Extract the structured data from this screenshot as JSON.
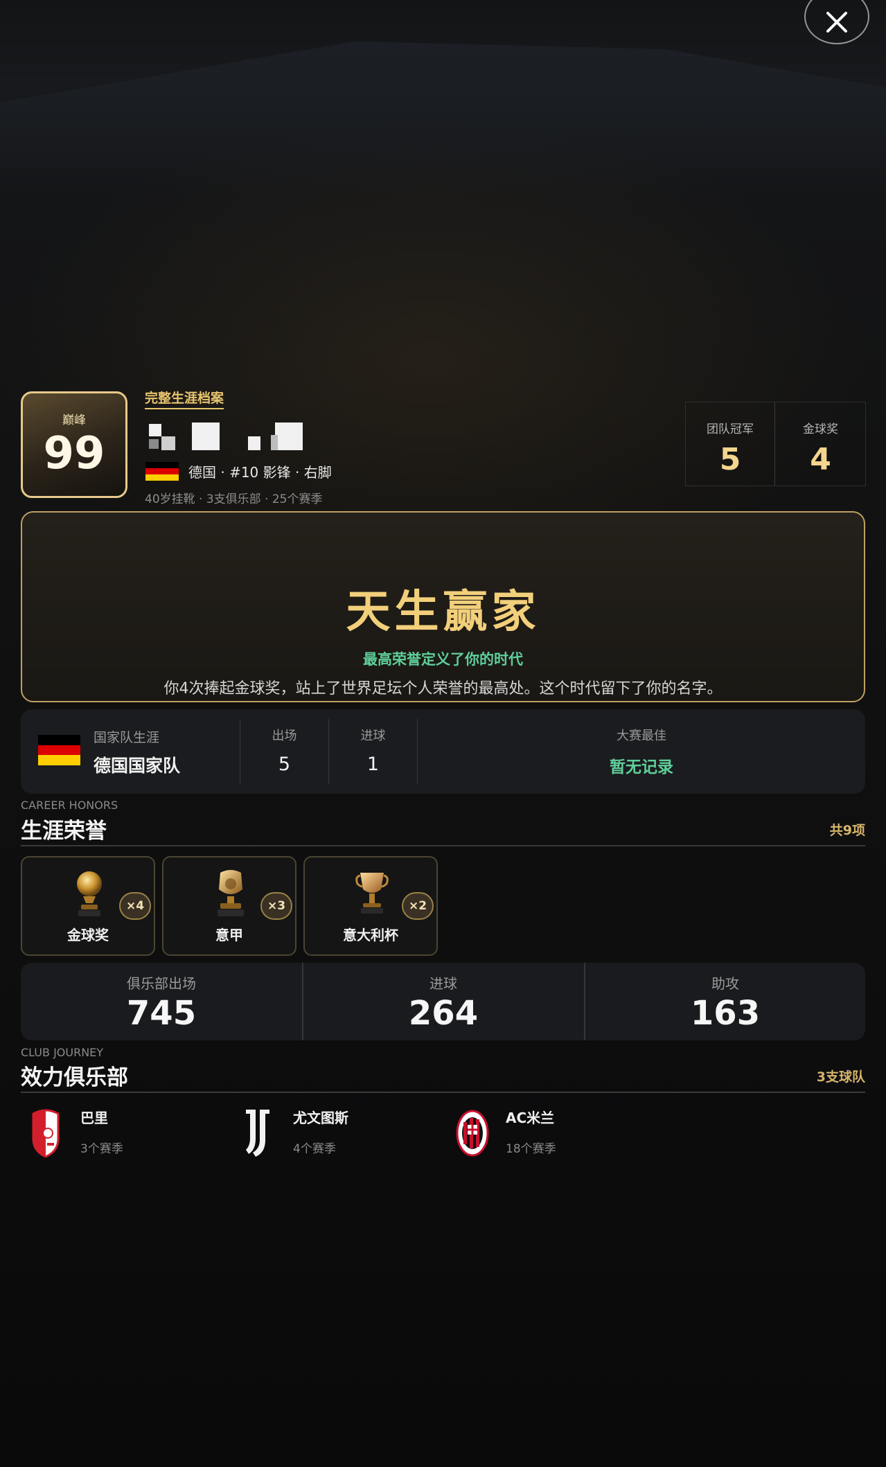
{
  "header": {
    "close_icon": "close-icon",
    "rating_label": "巅峰",
    "rating_value": "99",
    "profile_tag": "完整生涯档案",
    "player_line": "德国 · #10 影锋 · 右脚",
    "meta_line": "40岁挂靴 · 3支俱乐部 · 25个赛季"
  },
  "top_stats": [
    {
      "label": "团队冠军",
      "value": "5"
    },
    {
      "label": "金球奖",
      "value": "4"
    }
  ],
  "hero": {
    "title": "天生赢家",
    "subtitle": "最高荣誉定义了你的时代",
    "description": "你4次捧起金球奖，站上了世界足坛个人荣誉的最高处。这个时代留下了你的名字。"
  },
  "national": {
    "label": "国家队生涯",
    "team": "德国国家队",
    "apps_label": "出场",
    "apps": "5",
    "goals_label": "进球",
    "goals": "1",
    "best_label": "大赛最佳",
    "best": "暂无记录"
  },
  "honors": {
    "title_en": "CAREER HONORS",
    "title": "生涯荣誉",
    "count": "共9项",
    "items": [
      {
        "label": "金球奖",
        "count": "×4",
        "icon": "golden-ball-icon"
      },
      {
        "label": "意甲",
        "count": "×3",
        "icon": "league-trophy-icon"
      },
      {
        "label": "意大利杯",
        "count": "×2",
        "icon": "cup-trophy-icon"
      }
    ]
  },
  "club_stats": [
    {
      "label": "俱乐部出场",
      "value": "745"
    },
    {
      "label": "进球",
      "value": "264"
    },
    {
      "label": "助攻",
      "value": "163"
    }
  ],
  "clubs": {
    "title_en": "CLUB JOURNEY",
    "title": "效力俱乐部",
    "count": "3支球队",
    "items": [
      {
        "name": "巴里",
        "seasons": "3个赛季",
        "icon": "bari-crest-icon"
      },
      {
        "name": "尤文图斯",
        "seasons": "4个赛季",
        "icon": "juventus-crest-icon"
      },
      {
        "name": "AC米兰",
        "seasons": "18个赛季",
        "icon": "ac-milan-crest-icon"
      }
    ]
  },
  "colors": {
    "gold": "#f2cf7a",
    "green": "#5fcf9a",
    "flag_black": "#000000",
    "flag_red": "#dd0000",
    "flag_gold": "#ffce00"
  }
}
